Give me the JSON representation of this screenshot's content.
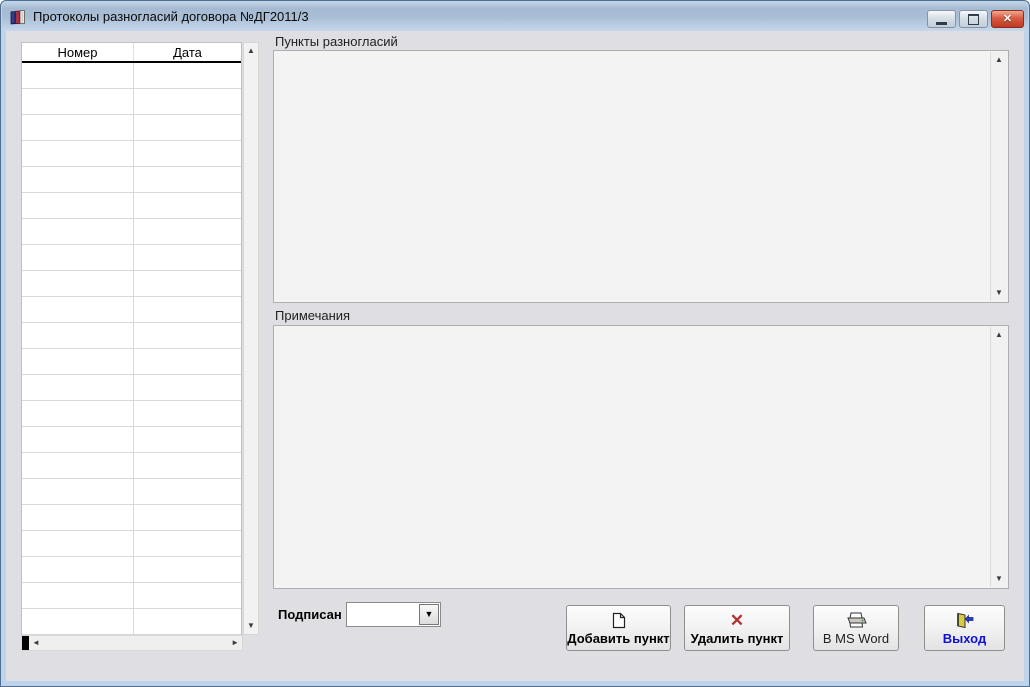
{
  "window": {
    "title": "Протоколы разногласий договора №ДГ2011/3",
    "icon": "books-icon",
    "controls": {
      "close_glyph": "✕"
    }
  },
  "table": {
    "columns": [
      "Номер",
      "Дата"
    ],
    "rows": [],
    "visible_empty_rows": 22
  },
  "sections": {
    "points_label": "Пункты разногласий",
    "points_text": "",
    "notes_label": "Примечания",
    "notes_text": ""
  },
  "footer": {
    "signed_label": "Подписан",
    "signed_value": "",
    "buttons": [
      {
        "label": "Добавить пункт",
        "icon": "new-document-icon"
      },
      {
        "label": "Удалить пункт",
        "icon": "delete-cross-icon"
      },
      {
        "label": "В MS Word",
        "icon": "printer-icon"
      },
      {
        "label": "Выход",
        "icon": "exit-door-icon"
      }
    ]
  },
  "icons": {
    "scroll_up": "▲",
    "scroll_down": "▼",
    "scroll_left": "◄",
    "scroll_right": "►",
    "dropdown": "▼",
    "delete_cross": "✕"
  },
  "colors": {
    "titlebar_top": "#a6bbd3",
    "titlebar_bottom": "#c7d8ec",
    "window_border_blue": "#bdd4ec",
    "client_bg": "#dfdfe3",
    "memo_bg": "#f3f3f3",
    "close_button_red": "#c64a32",
    "exit_text_blue": "#1010d6",
    "delete_cross_red": "#b03333"
  }
}
